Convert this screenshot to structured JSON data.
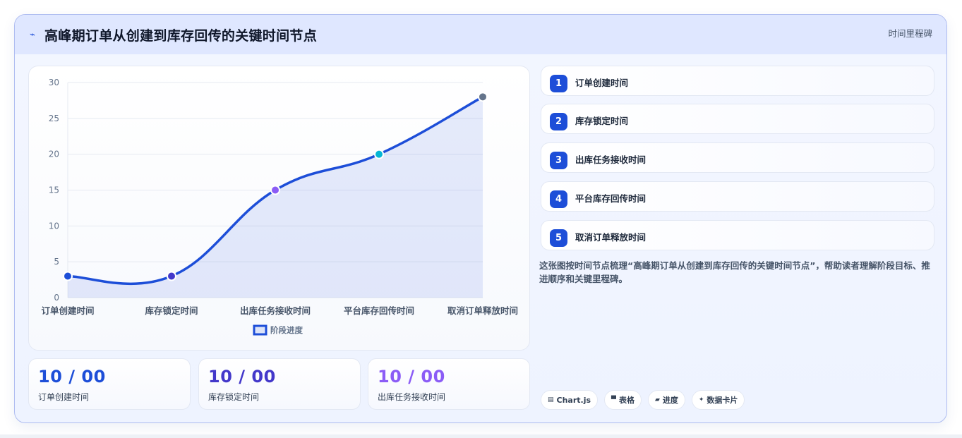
{
  "header": {
    "title": "高峰期订单从创建到库存回传的关键时间节点",
    "tag": "时间里程碑"
  },
  "chart_data": {
    "type": "line",
    "categories": [
      "订单创建时间",
      "库存锁定时间",
      "出库任务接收时间",
      "平台库存回传时间",
      "取消订单释放时间"
    ],
    "series": [
      {
        "name": "阶段进度",
        "values": [
          3,
          3,
          15,
          20,
          28
        ],
        "color": "#1d4ed8",
        "point_colors": [
          "#1d4ed8",
          "#4338ca",
          "#8b5cf6",
          "#06b6d4",
          "#64748b"
        ]
      }
    ],
    "ylim": [
      0,
      30
    ],
    "yticks": [
      0,
      5,
      10,
      15,
      20,
      25,
      30
    ],
    "grid": true,
    "fill": true,
    "legend": "bottom"
  },
  "stats": [
    {
      "value": "10 / 00",
      "label": "订单创建时间",
      "color": "#1d4ed8"
    },
    {
      "value": "10 / 00",
      "label": "库存锁定时间",
      "color": "#4338ca"
    },
    {
      "value": "10 / 00",
      "label": "出库任务接收时间",
      "color": "#8b5cf6"
    }
  ],
  "milestones": [
    {
      "num": "1",
      "label": "订单创建时间"
    },
    {
      "num": "2",
      "label": "库存锁定时间"
    },
    {
      "num": "3",
      "label": "出库任务接收时间"
    },
    {
      "num": "4",
      "label": "平台库存回传时间"
    },
    {
      "num": "5",
      "label": "取消订单释放时间"
    }
  ],
  "description": "这张图按时间节点梳理“高峰期订单从创建到库存回传的关键时间节点”，帮助读者理解阶段目标、推进顺序和关键里程碑。",
  "tags": [
    {
      "icon": "▤",
      "label": "Chart.js"
    },
    {
      "icon": "▀",
      "label": "表格"
    },
    {
      "icon": "▰",
      "label": "进度"
    },
    {
      "icon": "✦",
      "label": "数据卡片"
    }
  ]
}
